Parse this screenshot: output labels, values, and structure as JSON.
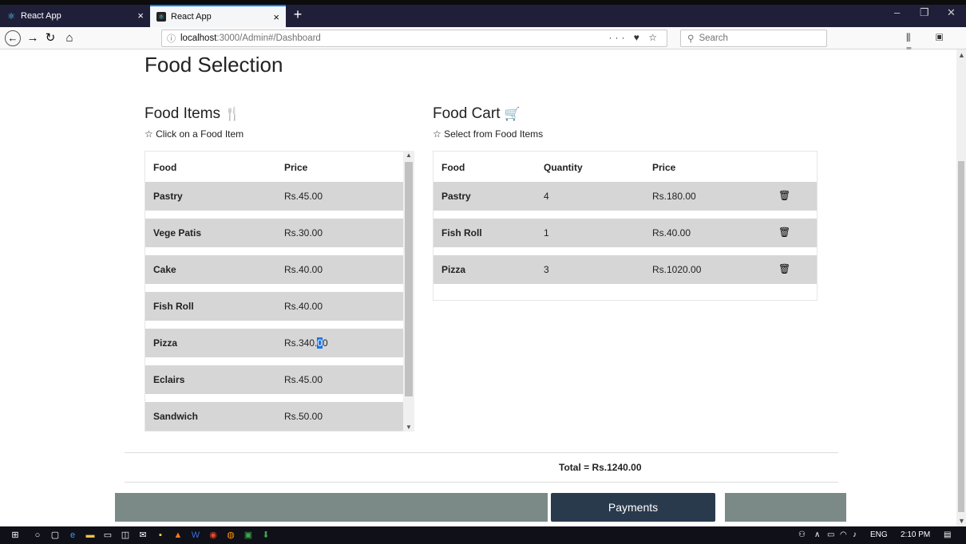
{
  "browser": {
    "tabs": [
      {
        "label": "React App",
        "icon": "react-icon",
        "active": false
      },
      {
        "label": "React App",
        "icon": "react-icon",
        "active": true
      }
    ],
    "tab_close": "×",
    "new_tab": "+",
    "window_controls": {
      "minimize": "–",
      "restore": "❐",
      "close": "✕"
    },
    "url": {
      "host": "localhost",
      "path": ":3000/Admin#/Dashboard"
    },
    "url_actions": "··· ♥ ☆",
    "search_placeholder": "Search",
    "tool_icons": "⫼ ▣ ≡"
  },
  "page": {
    "title": "Food Selection",
    "food_items": {
      "heading": "Food Items",
      "hint": "Click on a Food Item",
      "columns": [
        "Food",
        "Price"
      ],
      "rows": [
        {
          "food": "Pastry",
          "price": "Rs.45.00"
        },
        {
          "food": "Vege Patis",
          "price": "Rs.30.00"
        },
        {
          "food": "Cake",
          "price": "Rs.40.00"
        },
        {
          "food": "Fish Roll",
          "price": "Rs.40.00"
        },
        {
          "food": "Pizza",
          "price_prefix": "Rs.340.",
          "price_sel": "0",
          "price_suffix": "0"
        },
        {
          "food": "Eclairs",
          "price": "Rs.45.00"
        },
        {
          "food": "Sandwich",
          "price": "Rs.50.00"
        }
      ]
    },
    "food_cart": {
      "heading": "Food Cart",
      "hint": "Select from Food Items",
      "columns": [
        "Food",
        "Quantity",
        "Price"
      ],
      "rows": [
        {
          "food": "Pastry",
          "quantity": "4",
          "price": "Rs.180.00"
        },
        {
          "food": "Fish Roll",
          "quantity": "1",
          "price": "Rs.40.00"
        },
        {
          "food": "Pizza",
          "quantity": "3",
          "price": "Rs.1020.00"
        }
      ]
    },
    "total": "Total = Rs.1240.00",
    "payments_button": "Payments"
  },
  "taskbar": {
    "tray_text": "ENG",
    "time": "2:10 PM"
  },
  "colors": {
    "row_bg": "#d6d6d6",
    "footer_bar": "#7b8a87",
    "payments_bg": "#293a4d",
    "tab_accent": "#0a84ff"
  }
}
